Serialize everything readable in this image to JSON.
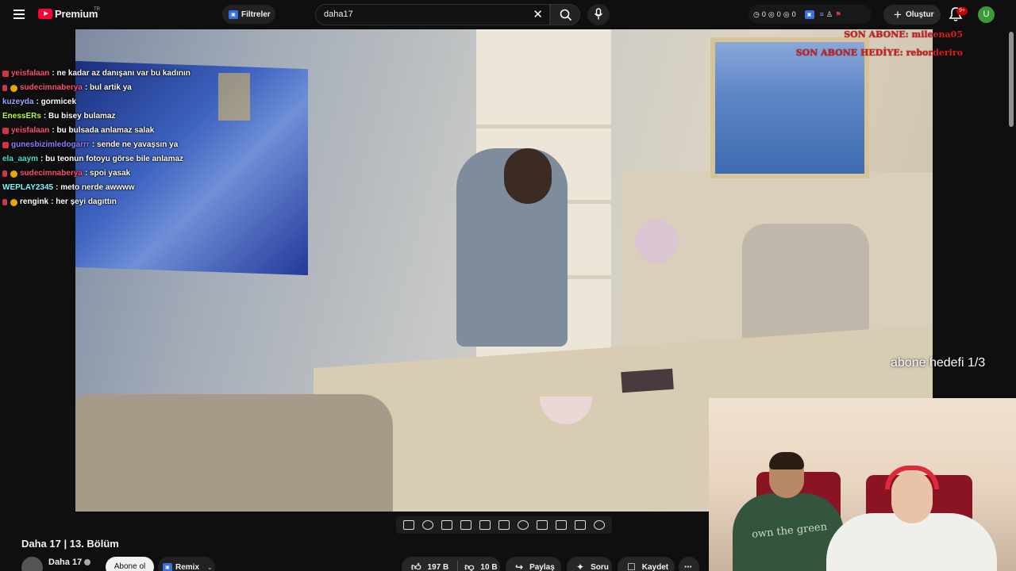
{
  "header": {
    "logo_text": "Premium",
    "logo_region": "TR",
    "filters_label": "Filtreler",
    "search_value": "daha17",
    "stats": [
      "0",
      "0",
      "0"
    ],
    "create_label": "Oluştur",
    "notification_count": "9+",
    "avatar_letter": "U"
  },
  "overlay": {
    "alerts": [
      "SON ABONE: mileena05",
      "SON ABONE HEDİYE: reborderiro"
    ],
    "goal": "abone hedefi 1/3"
  },
  "chat": [
    {
      "user": "yeisfalaan",
      "message": ": ne kadar az danışanı var bu kadının",
      "color": "#ff4f6d",
      "badge": "red"
    },
    {
      "user": "sudecimnaberya",
      "message": ": bul artik ya",
      "color": "#ff4f6d",
      "badge": "sub-gold"
    },
    {
      "user": "kuzeyda",
      "message": ": gormicek",
      "color": "#9ea9ff",
      "badge": ""
    },
    {
      "user": "EnessERs",
      "message": ": Bu bisey bulamaz",
      "color": "#b6ff3b",
      "badge": ""
    },
    {
      "user": "yeisfalaan",
      "message": ": bu bulsada anlamaz salak",
      "color": "#ff4f6d",
      "badge": "red"
    },
    {
      "user": "gunesbizimledogarrr",
      "message": ": sende ne yavaşsın ya",
      "color": "#8d7bff",
      "badge": "red"
    },
    {
      "user": "ela_aaym",
      "message": ": bu teonun fotoyu görse bile anlamaz",
      "color": "#47e0c9",
      "badge": ""
    },
    {
      "user": "sudecimnaberya",
      "message": ": spoi yasak",
      "color": "#ff4f6d",
      "badge": "sub-gold"
    },
    {
      "user": "WEPLAY2345",
      "message": ": meto nerde awwww",
      "color": "#7cf5ff",
      "badge": ""
    },
    {
      "user": "rengink",
      "message": ": her şeyi dagıttın",
      "color": "#ffffff",
      "badge": "sub-gold"
    }
  ],
  "webcam": {
    "shirt_text": "own the green"
  },
  "video_info": {
    "title": "Daha 17 | 13. Bölüm",
    "channel": "Daha 17",
    "subscribe_label": "Abone ol",
    "remix_label": "Remix",
    "likes": "197 B",
    "dislikes": "10 B",
    "share_label": "Paylaş",
    "ask_label": "Soru",
    "save_label": "Kaydet"
  },
  "colors": {
    "youtube_red": "#ff0033",
    "alert_red": "#e11b1b",
    "background": "#0f0f0f"
  }
}
